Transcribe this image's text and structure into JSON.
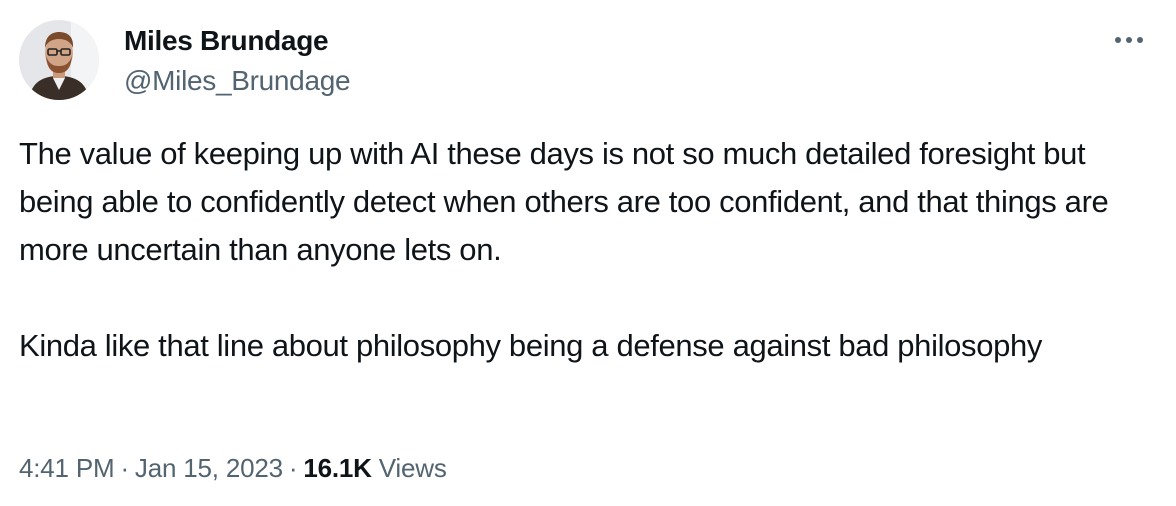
{
  "author": {
    "name": "Miles Brundage",
    "handle": "@Miles_Brundage"
  },
  "icons": {
    "more": "more-options-icon",
    "avatar": "profile-photo"
  },
  "tweet": {
    "paragraph_1": "The value of keeping up with AI these days is not so much detailed foresight but being able to confidently detect when others are too confident, and that things are more uncertain than anyone lets on.",
    "paragraph_2": "Kinda like that line about philosophy being a defense against bad philosophy"
  },
  "meta": {
    "time": "4:41 PM",
    "separator": "·",
    "date": "Jan 15, 2023",
    "views_count": "16.1K",
    "views_label": "Views"
  },
  "colors": {
    "text": "#0f1419",
    "secondary": "#536471",
    "background": "#ffffff"
  }
}
